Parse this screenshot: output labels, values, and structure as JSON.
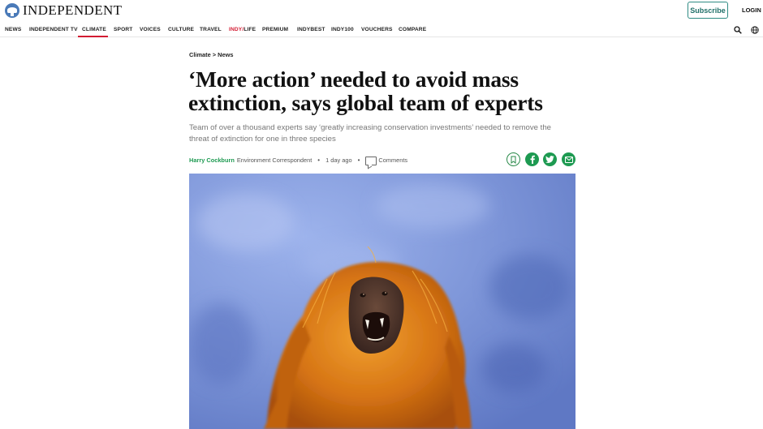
{
  "header": {
    "logo_text": "INDEPENDENT",
    "subscribe_label": "Subscribe",
    "login_label": "LOGIN"
  },
  "nav": {
    "items": [
      {
        "label": "NEWS"
      },
      {
        "label": "INDEPENDENT TV"
      },
      {
        "label": "CLIMATE",
        "active": true
      },
      {
        "label": "SPORT"
      },
      {
        "label": "VOICES"
      },
      {
        "label": "CULTURE"
      },
      {
        "label": "TRAVEL"
      },
      {
        "label_red": "INDY/",
        "label": "LIFE"
      },
      {
        "label": "PREMIUM"
      },
      {
        "label": "INDYBEST"
      },
      {
        "label": "INDY100"
      },
      {
        "label": "VOUCHERS"
      },
      {
        "label": "COMPARE"
      }
    ],
    "search_icon": "search-icon",
    "globe_icon": "globe-icon"
  },
  "article": {
    "breadcrumb": "Climate > News",
    "headline": "‘More action’ needed to avoid mass extinction, says global team of experts",
    "standfirst": "Team of over a thousand experts say ‘greatly increasing conservation investments’ needed to remove the threat of extinction for one in three species",
    "author": "Harry Cockburn",
    "author_role": "Environment Correspondent",
    "separator": "•",
    "time": "1 day ago",
    "comments_label": "Comments"
  },
  "share": {
    "bookmark_icon": "bookmark-icon",
    "facebook_icon": "facebook-icon",
    "twitter_icon": "twitter-icon",
    "email_icon": "email-icon"
  },
  "colors": {
    "accent_red": "#d31b32",
    "accent_green": "#1d9a51",
    "subscribe_teal": "#2e8b83"
  }
}
